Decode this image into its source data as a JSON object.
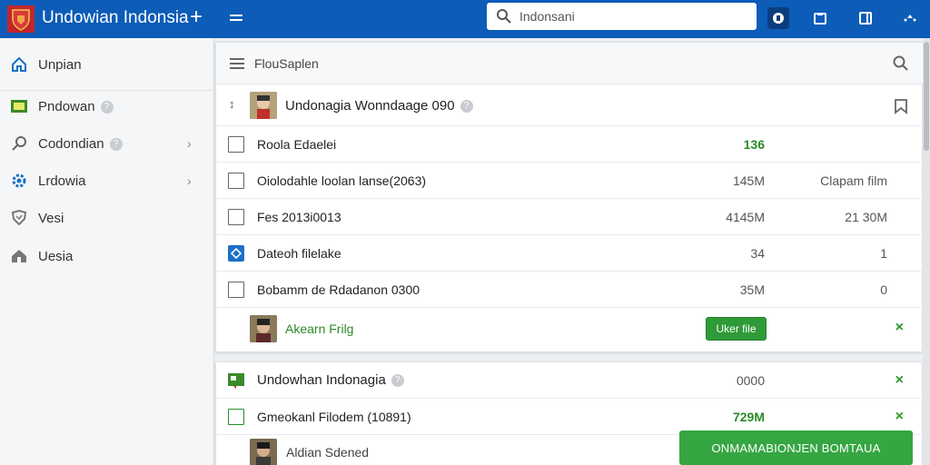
{
  "app": {
    "title": "Undowian Indonsia",
    "accent_color": "#0c5cb8"
  },
  "search": {
    "value": "Indonsani",
    "placeholder": ""
  },
  "sidebar": {
    "items": [
      {
        "label": "Unpian",
        "icon": "home-icon"
      },
      {
        "label": "Pndowan",
        "icon": "green-square-icon",
        "badge": "?"
      },
      {
        "label": "Codondian",
        "icon": "search-icon",
        "badge": "?"
      },
      {
        "label": "Lrdowia",
        "icon": "gear-icon"
      },
      {
        "label": "Vesi",
        "icon": "shield-icon"
      },
      {
        "label": "Uesia",
        "icon": "home-alt-icon"
      }
    ]
  },
  "main": {
    "toolbar_title": "FlouSaplen",
    "header_title": "Undonagia Wonndaage 090",
    "header_badge": "?",
    "rows": [
      {
        "name": "Roola Edaelei",
        "col_a": "",
        "col_b": "",
        "col_mid": "136"
      },
      {
        "name": "Oiolodahle loolan lanse(2063)",
        "col_a": "145M",
        "col_b": "Clapam film"
      },
      {
        "name": "Fes 2013i0013",
        "col_a": "4145M",
        "col_b": "21 30M"
      },
      {
        "name": "Dateoh filelake",
        "col_a": "34",
        "col_b": "1"
      },
      {
        "name": "Bobamm de Rdadanon 0300",
        "col_a": "35M",
        "col_b": "0"
      }
    ],
    "upload_row": {
      "name": "Akearn Frilg",
      "button": "Uker file",
      "x_icon": "×"
    },
    "second_card": {
      "title": "Undowhan Indonagia",
      "title_badge": "?",
      "title_value": "0000",
      "x_icon": "×",
      "row": {
        "name": "Gmeokanl Filodem (10891)",
        "value": "729M",
        "x_icon": "×"
      },
      "bottom_row": {
        "name": "Aldian Sdened"
      }
    },
    "primary_button": "ONMAMABIONJEN BOMTAUA"
  }
}
